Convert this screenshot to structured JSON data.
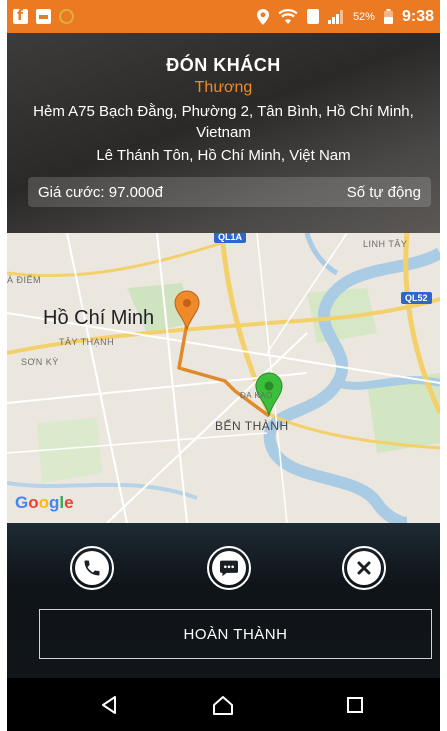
{
  "status_bar": {
    "battery_percent": "52%",
    "time": "9:38",
    "icons": [
      "facebook-icon",
      "gallery-icon",
      "check-circle-icon",
      "location-pin-icon",
      "wifi-icon",
      "sim-icon",
      "signal-icon",
      "battery-icon"
    ]
  },
  "header": {
    "title": "ĐÓN KHÁCH",
    "customer_name": "Thương",
    "pickup_address": "Hẻm A75 Bạch Đằng, Phường 2, Tân Bình, Hồ Chí Minh, Vietnam",
    "dropoff_address": "Lê Thánh Tôn, Hồ Chí Minh, Việt Nam",
    "fare_label": "Giá cước:",
    "fare_value": "97.000đ",
    "meter_mode": "Số tự động"
  },
  "map": {
    "city_label": "Hồ Chí Minh",
    "district_labels": [
      "TÂY THẠNH",
      "SƠN KỲ",
      "À ĐIỂM",
      "LINH TÂY",
      "ĐA KAO"
    ],
    "landmark_label": "BẾN THÀNH",
    "road_shields": [
      "QL1A",
      "QL52"
    ],
    "attribution": "Google",
    "pickup_marker_color": "#ef8a2a",
    "destination_marker_color": "#3bbf3b",
    "route_color": "#e08a2c"
  },
  "actions": {
    "call_icon": "phone-icon",
    "message_icon": "chat-bubble-icon",
    "cancel_icon": "close-icon",
    "complete_label": "HOÀN THÀNH"
  },
  "navbar": {
    "icons": [
      "back-triangle-icon",
      "home-circle-icon",
      "recent-apps-square-icon"
    ]
  },
  "colors": {
    "accent_orange": "#ec7a22",
    "customer_name": "#ef8a2a",
    "header_bg": "#2b2928",
    "actions_bg": "#111519"
  }
}
